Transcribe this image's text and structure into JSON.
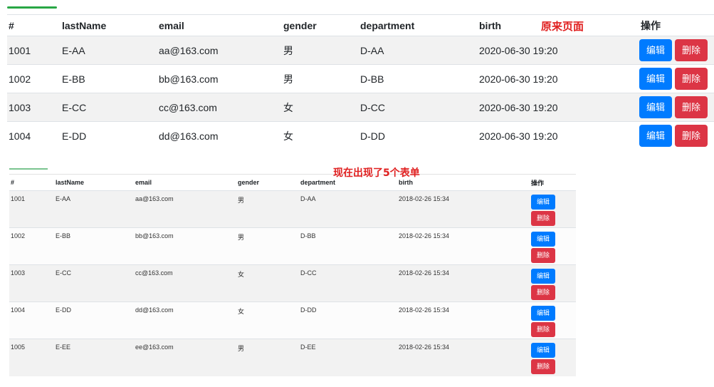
{
  "top": {
    "annotation": "原来页面",
    "headers": [
      "#",
      "lastName",
      "email",
      "gender",
      "department",
      "birth",
      "操作"
    ],
    "edit_label": "编辑",
    "delete_label": "删除",
    "rows": [
      {
        "id": "1001",
        "lastName": "E-AA",
        "email": "aa@163.com",
        "gender": "男",
        "department": "D-AA",
        "birth": "2020-06-30 19:20"
      },
      {
        "id": "1002",
        "lastName": "E-BB",
        "email": "bb@163.com",
        "gender": "男",
        "department": "D-BB",
        "birth": "2020-06-30 19:20"
      },
      {
        "id": "1003",
        "lastName": "E-CC",
        "email": "cc@163.com",
        "gender": "女",
        "department": "D-CC",
        "birth": "2020-06-30 19:20"
      },
      {
        "id": "1004",
        "lastName": "E-DD",
        "email": "dd@163.com",
        "gender": "女",
        "department": "D-DD",
        "birth": "2020-06-30 19:20"
      }
    ]
  },
  "bottom": {
    "annotation": "现在出现了5个表单",
    "headers": [
      "#",
      "lastName",
      "email",
      "gender",
      "department",
      "birth",
      "操作"
    ],
    "edit_label": "编辑",
    "delete_label": "删除",
    "rows": [
      {
        "id": "1001",
        "lastName": "E-AA",
        "email": "aa@163.com",
        "gender": "男",
        "department": "D-AA",
        "birth": "2018-02-26 15:34"
      },
      {
        "id": "1002",
        "lastName": "E-BB",
        "email": "bb@163.com",
        "gender": "男",
        "department": "D-BB",
        "birth": "2018-02-26 15:34"
      },
      {
        "id": "1003",
        "lastName": "E-CC",
        "email": "cc@163.com",
        "gender": "女",
        "department": "D-CC",
        "birth": "2018-02-26 15:34"
      },
      {
        "id": "1004",
        "lastName": "E-DD",
        "email": "dd@163.com",
        "gender": "女",
        "department": "D-DD",
        "birth": "2018-02-26 15:34"
      },
      {
        "id": "1005",
        "lastName": "E-EE",
        "email": "ee@163.com",
        "gender": "男",
        "department": "D-EE",
        "birth": "2018-02-26 15:34"
      }
    ]
  },
  "colors": {
    "accent_green": "#28a745",
    "edit_blue": "#007bff",
    "delete_red": "#dc3545",
    "annotation_red": "#e02020"
  }
}
